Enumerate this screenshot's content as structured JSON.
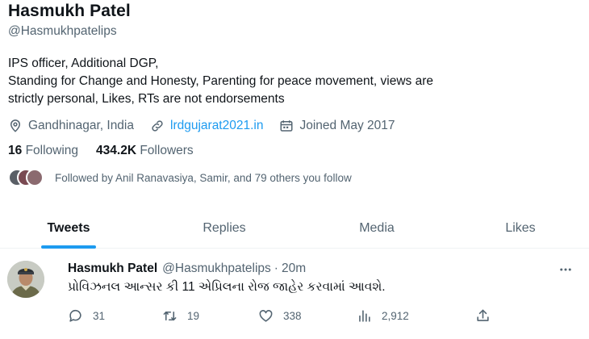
{
  "profile": {
    "name": "Hasmukh Patel",
    "handle": "@Hasmukhpatelips",
    "bio": [
      "IPS officer, Additional DGP,",
      "Standing for Change and Honesty, Parenting for peace movement, views are",
      "strictly personal, Likes, RTs are not endorsements"
    ],
    "location": "Gandhinagar, India",
    "website": "lrdgujarat2021.in",
    "joined": "Joined May 2017",
    "following_count": "16",
    "following_label": "Following",
    "followers_count": "434.2K",
    "followers_label": "Followers",
    "followed_by": "Followed by Anil Ranavasiya, Samir, and 79 others you follow"
  },
  "tabs": [
    {
      "label": "Tweets",
      "active": true
    },
    {
      "label": "Replies",
      "active": false
    },
    {
      "label": "Media",
      "active": false
    },
    {
      "label": "Likes",
      "active": false
    }
  ],
  "tweet": {
    "author_name": "Hasmukh Patel",
    "author_handle": "@Hasmukhpatelips",
    "separator": "·",
    "time": "20m",
    "text": "પ્રોવિઝનલ આન્સર કી 11 એપ્રિલના રોજ જાહેર કરવામાં આવશે.",
    "replies": "31",
    "retweets": "19",
    "likes": "338",
    "views": "2,912"
  },
  "colors": {
    "accent": "#1d9bf0",
    "secondary_text": "#536471",
    "primary_text": "#0f1419"
  },
  "icons": {
    "location": "location-pin-icon",
    "link": "link-icon",
    "calendar": "calendar-icon",
    "reply": "reply-icon",
    "retweet": "retweet-icon",
    "like": "heart-icon",
    "views": "views-chart-icon",
    "share": "share-icon",
    "more": "more-icon"
  }
}
